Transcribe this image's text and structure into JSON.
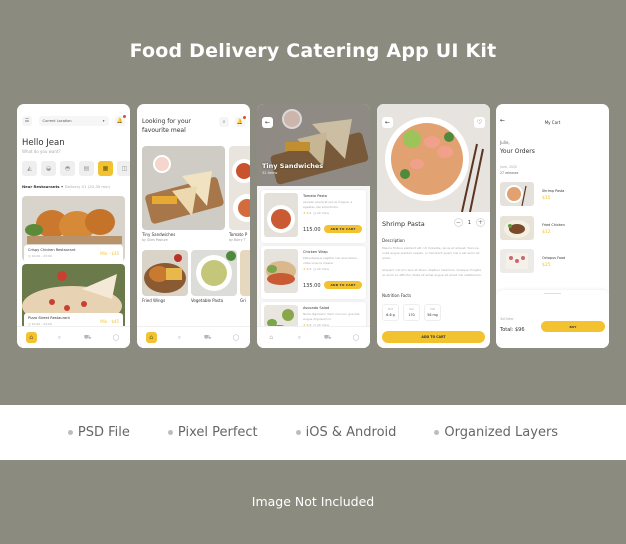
{
  "title": "Food Delivery Catering App UI Kit",
  "footer_note": "Image Not Included",
  "features": [
    "PSD File",
    "Pixel Perfect",
    "iOS & Android",
    "Organized Layers"
  ],
  "colors": {
    "background": "#8c8b80",
    "accent": "#f2c230",
    "band": "#ffffff"
  },
  "bottom_nav": [
    "home-icon",
    "search-icon",
    "cart-icon",
    "user-icon"
  ],
  "home": {
    "location_select": "Current Location",
    "greeting": "Hello Jean",
    "subtitle": "What do you want?",
    "categories": [
      "pizza-icon",
      "bowl-icon",
      "dish-icon",
      "drink-icon",
      "burger-icon",
      "more-icon"
    ],
    "section_title": "Near Restaurants",
    "section_sub": "Delivery 01 (20-30 min)",
    "restaurants": [
      {
        "name": "Crispy Chicken Restaurant",
        "hours": "10:00 - 23:00",
        "min": "Min - $35"
      },
      {
        "name": "Pizza Street Restaurant",
        "hours": "10:00 - 23:00",
        "min": "Min - $45"
      }
    ]
  },
  "browse": {
    "title": "Looking for your favourite meal",
    "featured": [
      {
        "name": "Tiny Sandwiches",
        "by": "by Giles Posture"
      },
      {
        "name": "Tomato P",
        "by": "by Barry T"
      }
    ],
    "small": [
      "Fried Wings",
      "Vegetable Pasta",
      "Gri"
    ]
  },
  "category": {
    "title": "Tiny Sandwiches",
    "count": "32 items",
    "products": [
      {
        "name": "Tomato Pasta",
        "desc": "Aenean placerat purus magna, a egestas nisi sollicitudin.",
        "rating": "4.6",
        "time": "20 mins",
        "price": "115.00",
        "button": "ADD TO CART"
      },
      {
        "name": "Chicken Wrap",
        "desc": "Pellentesque sagittis nisi eros libero, vitae viverra massa.",
        "rating": "4.6",
        "time": "20 mins",
        "price": "135.00",
        "button": "ADD TO CART"
      },
      {
        "name": "Avocado Salad",
        "desc": "Nulla dignissim dolor nisi non gravida augue dignissim in.",
        "rating": "4.6",
        "time": "20 mins",
        "price": "",
        "button": ""
      }
    ]
  },
  "detail": {
    "title": "Shrimp Pasta",
    "qty": "1",
    "description_title": "Description",
    "description_1": "Mauris finibus eleifend elit. Ut molestie, lacus et aliquet rhoncus, nulla augue pretium sapien, in hendrerit quam nisl a est enim sit amet.",
    "description_2": "Aliquam rutrum risus at libero dapibus maximus. Quisque fringilla ac enim ac efficitur. Nulla sit amet augue sit amet nisl vestibulum.",
    "nutrition_title": "Nutrition Facts",
    "nutrition": [
      {
        "label": "Prot",
        "value": "6.6 g"
      },
      {
        "label": "Kal",
        "value": "170"
      },
      {
        "label": "Vdd",
        "value": "56 mg"
      }
    ],
    "button": "ADD TO CART"
  },
  "cart": {
    "title": "My Cart",
    "name": "Julie,",
    "heading": "Your Orders",
    "date": "June, 2020",
    "releases": "27 releases",
    "orders": [
      {
        "name": "Shrimp Pasta",
        "price": "$15"
      },
      {
        "name": "Fried Chicken",
        "price": "$12"
      },
      {
        "name": "Octopus Food",
        "price": "$25"
      }
    ],
    "count": "3xOrder",
    "total": "Total: $96",
    "buy": "BUY"
  }
}
